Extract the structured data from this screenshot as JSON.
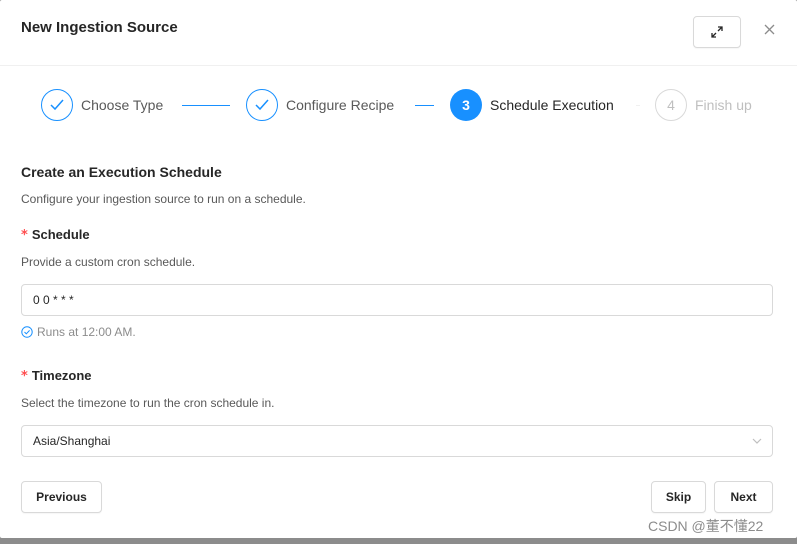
{
  "modal": {
    "title": "New Ingestion Source"
  },
  "steps": [
    {
      "label": "Choose Type",
      "status": "done"
    },
    {
      "label": "Configure Recipe",
      "status": "done"
    },
    {
      "number": "3",
      "label": "Schedule Execution",
      "status": "active"
    },
    {
      "number": "4",
      "label": "Finish up",
      "status": "wait"
    }
  ],
  "section": {
    "title": "Create an Execution Schedule",
    "description": "Configure your ingestion source to run on a schedule."
  },
  "schedule": {
    "required_mark": "*",
    "label": "Schedule",
    "help": "Provide a custom cron schedule.",
    "value": "0 0 * * *",
    "hint": "Runs at 12:00 AM."
  },
  "timezone": {
    "required_mark": "*",
    "label": "Timezone",
    "help": "Select the timezone to run the cron schedule in.",
    "selected": "Asia/Shanghai"
  },
  "footer": {
    "previous_label": "Previous",
    "skip_label": "Skip",
    "next_label": "Next"
  },
  "watermark": "CSDN @董不懂22",
  "colors": {
    "accent": "#1890ff",
    "required": "#ff4d4f",
    "border": "#d9d9d9"
  }
}
